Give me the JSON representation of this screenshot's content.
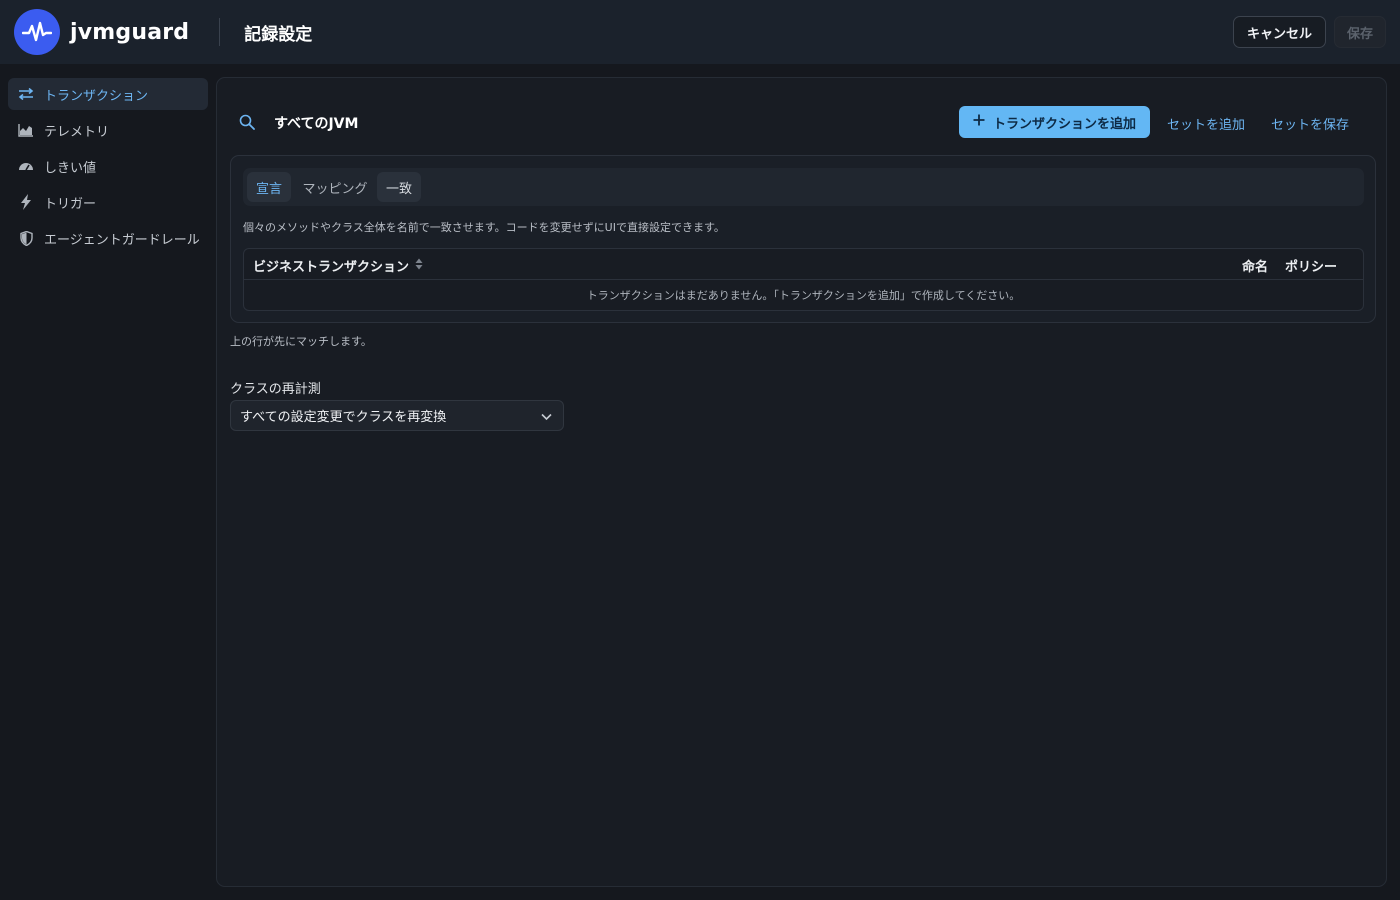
{
  "header": {
    "brand": "jvmguard",
    "page_title": "記録設定",
    "cancel_label": "キャンセル",
    "save_label": "保存"
  },
  "sidebar": {
    "items": [
      {
        "label": "トランザクション",
        "icon": "arrows-transfer-icon",
        "active": true
      },
      {
        "label": "テレメトリ",
        "icon": "area-chart-icon",
        "active": false
      },
      {
        "label": "しきい値",
        "icon": "gauge-icon",
        "active": false
      },
      {
        "label": "トリガー",
        "icon": "lightning-icon",
        "active": false
      },
      {
        "label": "エージェントガードレール",
        "icon": "shield-icon",
        "active": false
      }
    ]
  },
  "toolbar": {
    "scope_title": "すべてのJVM",
    "add_transaction_label": "トランザクションを追加",
    "add_set_label": "セットを追加",
    "save_set_label": "セットを保存"
  },
  "tabs": [
    {
      "label": "宣言",
      "active": true
    },
    {
      "label": "マッピング",
      "active": false
    },
    {
      "label": "一致",
      "active": false
    }
  ],
  "card": {
    "description": "個々のメソッドやクラス全体を名前で一致させます。コードを変更せずにUIで直接設定できます。"
  },
  "table": {
    "columns": [
      "ビジネストランザクション",
      "命名",
      "ポリシー"
    ],
    "empty_message": "トランザクションはまだありません。「トランザクションを追加」で作成してください。"
  },
  "order_note": "上の行が先にマッチします。",
  "retransform": {
    "label": "クラスの再計測",
    "selected_value": "すべての設定変更でクラスを再変換"
  },
  "colors": {
    "accent": "#63b7f4",
    "brand_logo": "#3b5cf0",
    "background": "#15181e"
  }
}
